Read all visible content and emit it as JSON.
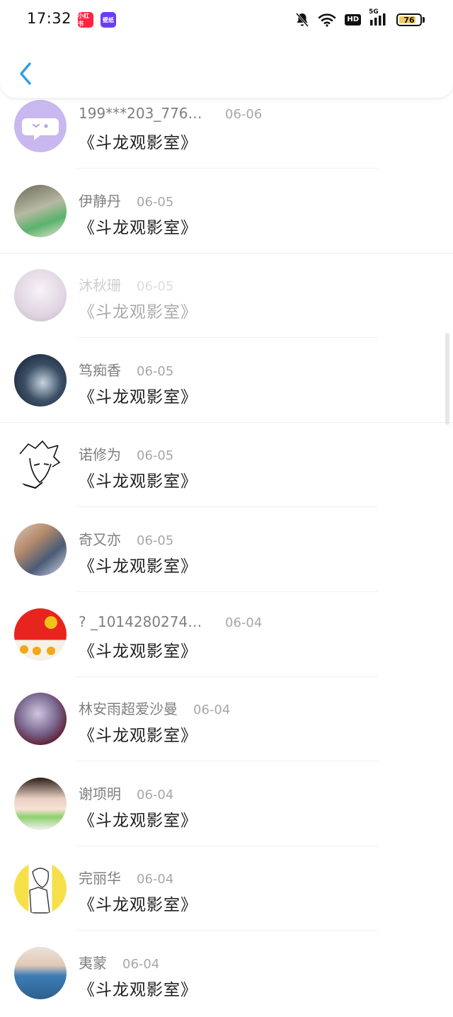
{
  "status_bar": {
    "time": "17:32",
    "notification_apps": [
      {
        "label": "小红书",
        "color": "#ff2442"
      },
      {
        "label": "壁纸",
        "color": "#6b3cf6"
      }
    ],
    "icons": [
      "bell-muted-icon",
      "wifi-icon",
      "hd-icon",
      "signal-5g-icon",
      "battery-icon"
    ],
    "hd_label": "HD",
    "network_label": "5G",
    "battery_level": "76"
  },
  "header": {
    "back_icon": "chevron-left-icon",
    "accent_color": "#2aa0e8"
  },
  "comments": [
    {
      "name": "199***203_77648...",
      "date": "06-06",
      "message": "《斗龙观影室》",
      "avatar": "default-chat-avatar"
    },
    {
      "name": "伊静丹",
      "date": "06-05",
      "message": "《斗龙观影室》",
      "avatar": "photo-avatar"
    },
    {
      "name": "沐秋珊",
      "date": "06-05",
      "message": "《斗龙观影室》",
      "avatar": "photo-avatar"
    },
    {
      "name": "笃痴香",
      "date": "06-05",
      "message": "《斗龙观影室》",
      "avatar": "photo-avatar"
    },
    {
      "name": "诺修为",
      "date": "06-05",
      "message": "《斗龙观影室》",
      "avatar": "sketch-avatar"
    },
    {
      "name": "奇又亦",
      "date": "06-05",
      "message": "《斗龙观影室》",
      "avatar": "photo-avatar"
    },
    {
      "name": "? _101428027451...",
      "date": "06-04",
      "message": "《斗龙观影室》",
      "avatar": "flower-avatar"
    },
    {
      "name": "林安雨超爱沙曼",
      "date": "06-04",
      "message": "《斗龙观影室》",
      "avatar": "anime-avatar"
    },
    {
      "name": "谢项明",
      "date": "06-04",
      "message": "《斗龙观影室》",
      "avatar": "photo-avatar"
    },
    {
      "name": "完丽华",
      "date": "06-04",
      "message": "《斗龙观影室》",
      "avatar": "sketch-avatar"
    },
    {
      "name": "夷蒙",
      "date": "06-04",
      "message": "《斗龙观影室》",
      "avatar": "photo-avatar"
    }
  ]
}
